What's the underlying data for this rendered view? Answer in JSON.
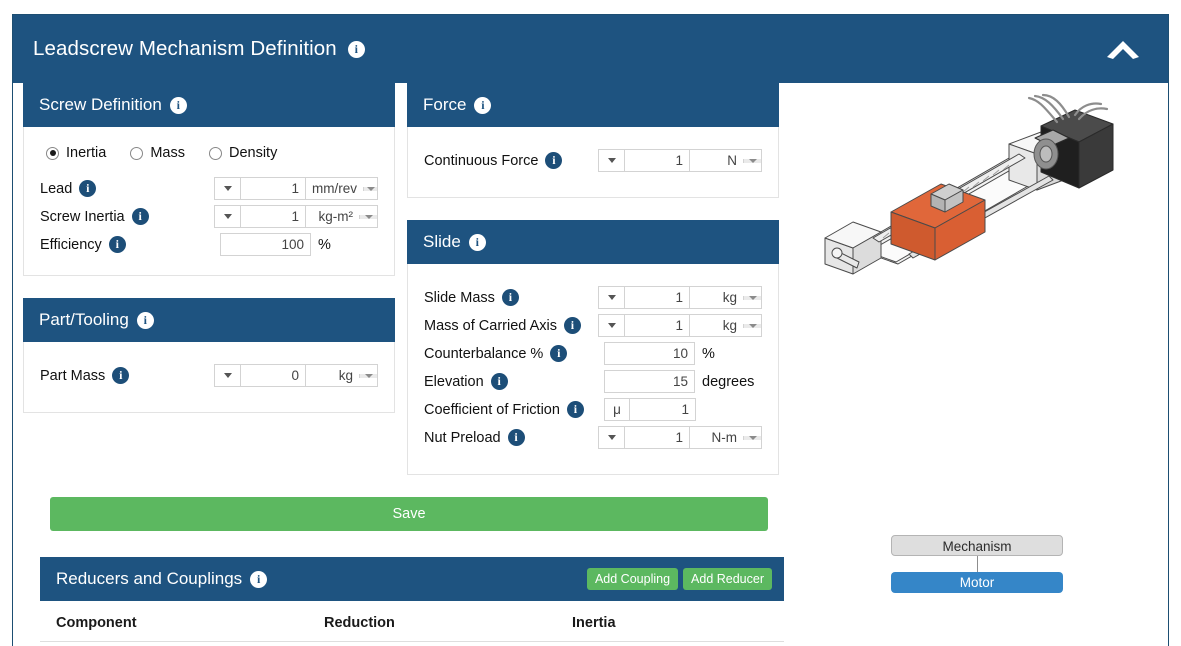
{
  "window": {
    "title": "Leadscrew Mechanism Definition",
    "title_info_icon": "info-icon",
    "collapse_icon": "chevron-up-icon"
  },
  "colors": {
    "panel_header": "#1e5380",
    "accent_green": "#5cb860",
    "motor_node": "#3586c8",
    "mechanism_node": "#dedede"
  },
  "screw_definition": {
    "title": "Screw Definition",
    "radios": [
      {
        "label": "Inertia",
        "checked": true
      },
      {
        "label": "Mass",
        "checked": false
      },
      {
        "label": "Density",
        "checked": false
      }
    ],
    "fields": [
      {
        "label": "Lead",
        "value": "1",
        "unit": "mm/rev",
        "has_spinner": true,
        "has_unit_select": true
      },
      {
        "label": "Screw Inertia",
        "value": "1",
        "unit": "kg-m²",
        "has_spinner": true,
        "has_unit_select": true
      },
      {
        "label": "Efficiency",
        "value": "100",
        "suffix": "%",
        "has_spinner": false,
        "has_unit_select": false
      }
    ]
  },
  "part_tooling": {
    "title": "Part/Tooling",
    "fields": [
      {
        "label": "Part Mass",
        "value": "0",
        "unit": "kg",
        "has_spinner": true,
        "has_unit_select": true
      }
    ]
  },
  "force": {
    "title": "Force",
    "fields": [
      {
        "label": "Continuous Force",
        "value": "1",
        "unit": "N",
        "has_spinner": true,
        "has_unit_select": true
      }
    ]
  },
  "slide": {
    "title": "Slide",
    "fields": [
      {
        "label": "Slide Mass",
        "value": "1",
        "unit": "kg",
        "has_spinner": true,
        "has_unit_select": true
      },
      {
        "label": "Mass of Carried Axis",
        "value": "1",
        "unit": "kg",
        "has_spinner": true,
        "has_unit_select": true
      },
      {
        "label": "Counterbalance %",
        "value": "10",
        "suffix": "%",
        "has_spinner": false,
        "has_unit_select": false
      },
      {
        "label": "Elevation",
        "value": "15",
        "suffix": "degrees",
        "has_spinner": false,
        "has_unit_select": false
      },
      {
        "label": "Coefficient of Friction",
        "value": "1",
        "prefix": "μ",
        "has_spinner": false,
        "has_unit_select": false
      },
      {
        "label": "Nut Preload",
        "value": "1",
        "unit": "N-m",
        "has_spinner": true,
        "has_unit_select": true
      }
    ]
  },
  "save": {
    "label": "Save"
  },
  "reducers": {
    "title": "Reducers and Couplings",
    "buttons": [
      {
        "label": "Add Coupling",
        "name": "add-coupling-button"
      },
      {
        "label": "Add Reducer",
        "name": "add-reducer-button"
      }
    ],
    "columns": [
      "Component",
      "Reduction",
      "Inertia"
    ],
    "rows": []
  },
  "diagram": {
    "illustration_name": "leadscrew-actuator-illustration",
    "nodes": [
      {
        "label": "Mechanism",
        "name": "tree-node-mechanism"
      },
      {
        "label": "Motor",
        "name": "tree-node-motor"
      }
    ]
  }
}
